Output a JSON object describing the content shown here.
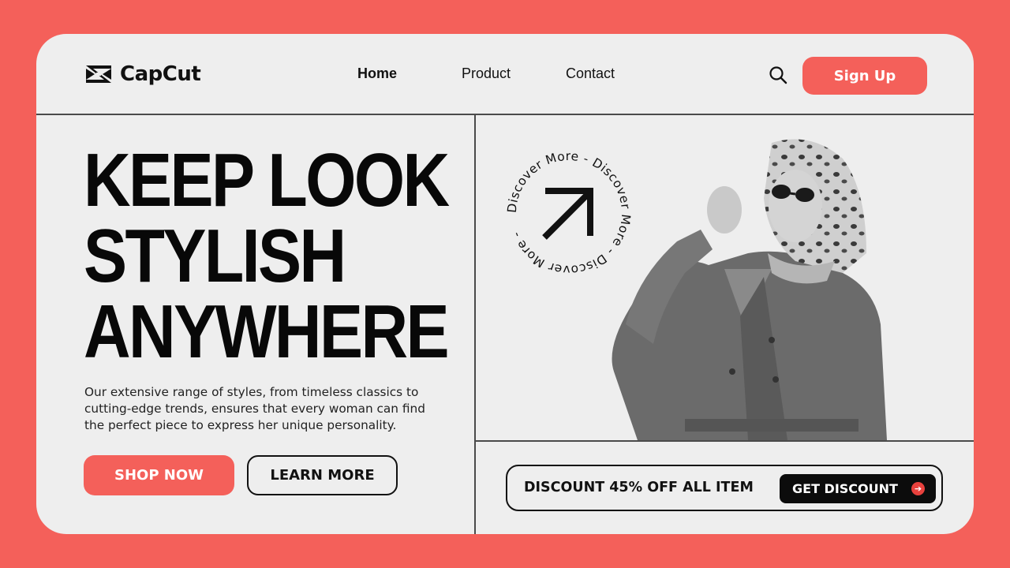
{
  "brand": {
    "name": "CapCut",
    "logo_icon": "capcut-logo-icon"
  },
  "nav": {
    "home": "Home",
    "product": "Product",
    "contact": "Contact"
  },
  "header": {
    "search_icon": "search-icon",
    "signup_label": "Sign Up"
  },
  "hero": {
    "headline_lines": [
      "KEEP LOOK",
      "STYLISH",
      "ANYWHERE"
    ],
    "description": "Our extensive range of styles, from timeless classics to cutting-edge trends, ensures that every woman can find the perfect piece to express her unique personality.",
    "shop_label": "SHOP NOW",
    "learn_label": "LEARN MORE"
  },
  "badge": {
    "circle_text": "Discover More - Discover More - Discover More - ",
    "icon": "arrow-up-right-icon"
  },
  "discount": {
    "text": "DISCOUNT 45% OFF ALL ITEM",
    "button_label": "GET DISCOUNT",
    "button_icon": "arrow-right-icon"
  },
  "colors": {
    "accent": "#f4605a",
    "background": "#eeeeee",
    "text": "#111111"
  }
}
